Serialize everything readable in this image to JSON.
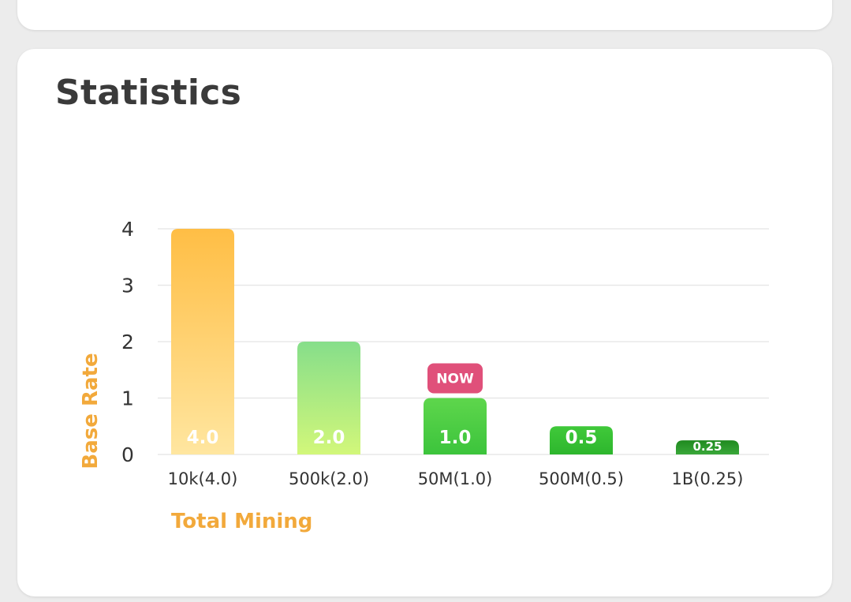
{
  "page": {
    "title": "Statistics"
  },
  "colors": {
    "axis_title": "#f2a93b",
    "now_badge": "#e0507a",
    "grid": "#e8e8e8"
  },
  "chart_data": {
    "type": "bar",
    "categories": [
      "10k(4.0)",
      "500k(2.0)",
      "50M(1.0)",
      "500M(0.5)",
      "1B(0.25)"
    ],
    "values": [
      4.0,
      2.0,
      1.0,
      0.5,
      0.25
    ],
    "data_labels": [
      "4.0",
      "2.0",
      "1.0",
      "0.5",
      "0.25"
    ],
    "xlabel": "Total Mining",
    "ylabel": "Base Rate",
    "ylim": [
      0,
      4
    ],
    "yticks": [
      "0",
      "1",
      "2",
      "3",
      "4"
    ],
    "grid": true,
    "highlight": {
      "category_index": 2,
      "label": "NOW"
    },
    "bar_colors": [
      [
        "#ffbe45",
        "#ffe6a0"
      ],
      [
        "#86de8a",
        "#d2f77a"
      ],
      [
        "#5ed64c",
        "#3cc43c"
      ],
      [
        "#40c93a",
        "#2db62d"
      ],
      [
        "#1f8a1f",
        "#3aa83a"
      ]
    ]
  }
}
